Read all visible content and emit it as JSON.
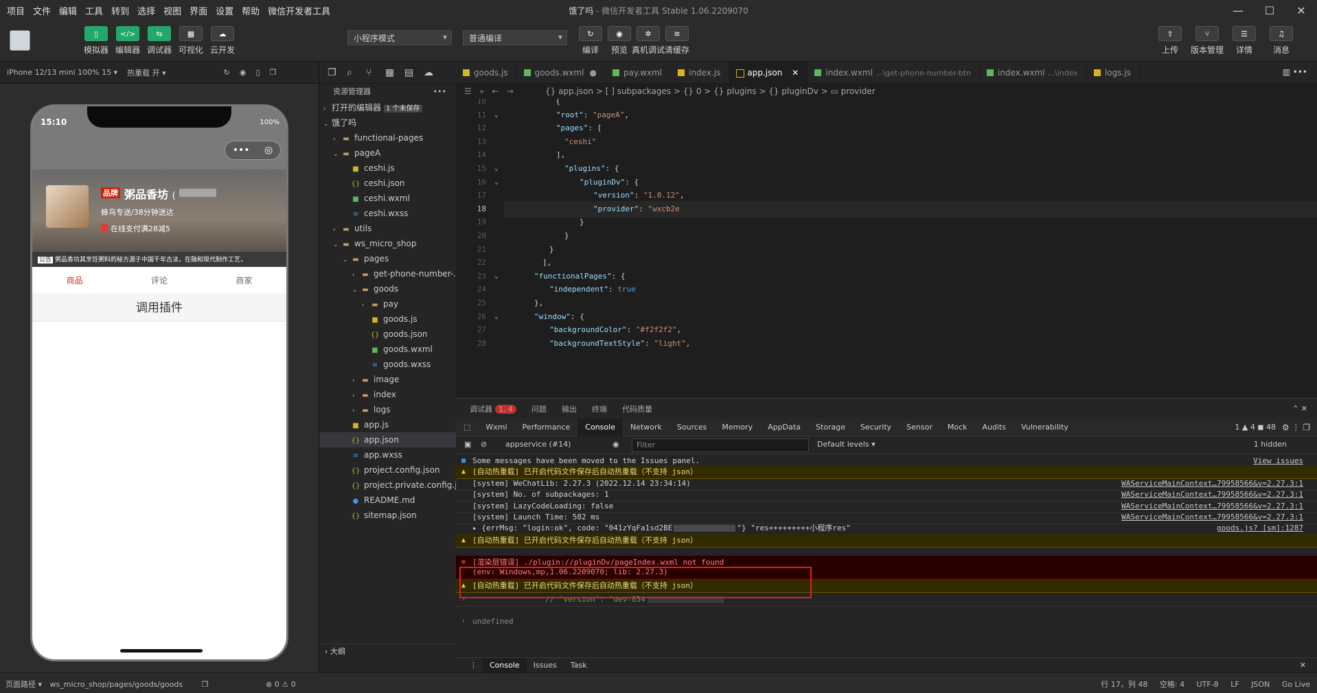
{
  "titlebar": {
    "menu": [
      "项目",
      "文件",
      "编辑",
      "工具",
      "转到",
      "选择",
      "视图",
      "界面",
      "设置",
      "帮助",
      "微信开发者工具"
    ],
    "app_name": "饿了吗",
    "app_title": " - 微信开发者工具 Stable 1.06.2209070"
  },
  "toolbar": {
    "left_buttons": [
      {
        "label": "模拟器",
        "icon": "phone-icon"
      },
      {
        "label": "编辑器",
        "icon": "code-icon"
      },
      {
        "label": "调试器",
        "icon": "debug-icon"
      },
      {
        "label": "可视化",
        "icon": "visual-icon"
      },
      {
        "label": "云开发",
        "icon": "cloud-icon"
      }
    ],
    "mode_select": "小程序模式",
    "compile_select": "普通编译",
    "mid_buttons": [
      {
        "label": "编译"
      },
      {
        "label": "预览"
      },
      {
        "label": "真机调试"
      },
      {
        "label": "清缓存"
      }
    ],
    "right_buttons": [
      {
        "label": "上传"
      },
      {
        "label": "版本管理"
      },
      {
        "label": "详情"
      },
      {
        "label": "消息"
      }
    ]
  },
  "simulator": {
    "device": "iPhone 12/13 mini 100% 15 ▾",
    "hot_reload": "热重载 开 ▾",
    "status_time": "15:10",
    "battery": "100%",
    "brand_badge": "品牌",
    "shop_name": "粥品香坊",
    "shop_suffix": "(",
    "delivery": "蜂鸟专送/38分钟送达",
    "promo": "在线支付满28减5",
    "notice_label": "公告",
    "notice_text": "粥品香坊其烹饪粥料的秘方源于中国千年古法，在融和现代制作工艺，",
    "tabs": [
      "商品",
      "评论",
      "商家"
    ],
    "plugin_button": "调用插件"
  },
  "explorer": {
    "header": "资源管理器",
    "open_editors": "打开的编辑器",
    "unsaved": "1 个未保存",
    "root": "饿了吗",
    "items": [
      {
        "label": "functional-pages",
        "indent": 1,
        "type": "folder",
        "arrow": "›"
      },
      {
        "label": "pageA",
        "indent": 1,
        "type": "folder",
        "arrow": "⌄"
      },
      {
        "label": "ceshi.js",
        "indent": 2,
        "type": "js",
        "arrow": ""
      },
      {
        "label": "ceshi.json",
        "indent": 2,
        "type": "json",
        "arrow": ""
      },
      {
        "label": "ceshi.wxml",
        "indent": 2,
        "type": "wxml",
        "arrow": ""
      },
      {
        "label": "ceshi.wxss",
        "indent": 2,
        "type": "wxss",
        "arrow": ""
      },
      {
        "label": "utils",
        "indent": 1,
        "type": "folder",
        "arrow": "›"
      },
      {
        "label": "ws_micro_shop",
        "indent": 1,
        "type": "folder",
        "arrow": "⌄"
      },
      {
        "label": "pages",
        "indent": 2,
        "type": "folder",
        "arrow": "⌄"
      },
      {
        "label": "get-phone-number-...",
        "indent": 3,
        "type": "folder",
        "arrow": "›"
      },
      {
        "label": "goods",
        "indent": 3,
        "type": "folder",
        "arrow": "⌄"
      },
      {
        "label": "pay",
        "indent": 4,
        "type": "folder",
        "arrow": "›"
      },
      {
        "label": "goods.js",
        "indent": 4,
        "type": "js",
        "arrow": ""
      },
      {
        "label": "goods.json",
        "indent": 4,
        "type": "json",
        "arrow": ""
      },
      {
        "label": "goods.wxml",
        "indent": 4,
        "type": "wxml",
        "arrow": ""
      },
      {
        "label": "goods.wxss",
        "indent": 4,
        "type": "wxss",
        "arrow": ""
      },
      {
        "label": "image",
        "indent": 3,
        "type": "folder",
        "arrow": "›"
      },
      {
        "label": "index",
        "indent": 3,
        "type": "folder",
        "arrow": "›"
      },
      {
        "label": "logs",
        "indent": 3,
        "type": "folder",
        "arrow": "›"
      },
      {
        "label": "app.js",
        "indent": 2,
        "type": "js",
        "arrow": ""
      },
      {
        "label": "app.json",
        "indent": 2,
        "type": "json",
        "arrow": "",
        "selected": true
      },
      {
        "label": "app.wxss",
        "indent": 2,
        "type": "wxss",
        "arrow": ""
      },
      {
        "label": "project.config.json",
        "indent": 2,
        "type": "json",
        "arrow": ""
      },
      {
        "label": "project.private.config.js...",
        "indent": 2,
        "type": "json",
        "arrow": ""
      },
      {
        "label": "README.md",
        "indent": 2,
        "type": "info",
        "arrow": ""
      },
      {
        "label": "sitemap.json",
        "indent": 2,
        "type": "json",
        "arrow": ""
      }
    ],
    "outline": "大纲"
  },
  "editor": {
    "tabs": [
      {
        "label": "goods.js",
        "sub": "",
        "kind": "js"
      },
      {
        "label": "goods.wxml",
        "sub": "",
        "kind": "wx",
        "dot": "●"
      },
      {
        "label": "pay.wxml",
        "sub": "",
        "kind": "wx"
      },
      {
        "label": "index.js",
        "sub": "",
        "kind": "js"
      },
      {
        "label": "app.json",
        "sub": "",
        "kind": "json",
        "active": true,
        "close": "✕"
      },
      {
        "label": "index.wxml",
        "sub": "...\\get-phone-number-btn",
        "kind": "wx"
      },
      {
        "label": "index.wxml",
        "sub": "...\\index",
        "kind": "wx"
      },
      {
        "label": "logs.js",
        "sub": "",
        "kind": "js"
      }
    ],
    "breadcrumb": "{} app.json > [ ] subpackages > {} 0 > {} plugins > {} pluginDv > ▭ provider",
    "lines": [
      {
        "n": "10",
        "text": "  {",
        "indent": 40,
        "fold": ""
      },
      {
        "n": "11",
        "text": "\"root\": \"pageA\",",
        "indent": 54,
        "fold": "⌄",
        "html": "<span class=\"k\">\"root\"</span>: <span class=\"s\">\"pageA\"</span>,"
      },
      {
        "n": "12",
        "text": "\"pages\": [",
        "indent": 54,
        "fold": "",
        "html": "<span class=\"k\">\"pages\"</span>: ["
      },
      {
        "n": "13",
        "text": "\"ceshi\"",
        "indent": 66,
        "fold": "",
        "html": "<span class=\"s\">\"ceshi\"</span>"
      },
      {
        "n": "14",
        "text": "],",
        "indent": 54,
        "fold": "",
        "html": "],"
      },
      {
        "n": "15",
        "text": "\"plugins\": {",
        "indent": 66,
        "fold": "⌄",
        "html": "<span class=\"k\">\"plugins\"</span>: {"
      },
      {
        "n": "16",
        "text": "\"pluginDv\": {",
        "indent": 88,
        "fold": "⌄",
        "html": "<span class=\"k\">\"pluginDv\"</span>: {"
      },
      {
        "n": "17",
        "text": "\"version\": \"1.0.12\",",
        "indent": 108,
        "fold": "",
        "html": "<span class=\"k\">\"version\"</span>: <span class=\"s\">\"1.0.12\"</span>,"
      },
      {
        "n": "18",
        "text": "\"provider\": \"wxcb2e",
        "indent": 108,
        "fold": "",
        "html": "<span class=\"k\">\"provider\"</span>: <span class=\"s\">\"wxcb2e</span>",
        "current": true
      },
      {
        "n": "19",
        "text": "}",
        "indent": 88,
        "fold": "",
        "html": "}"
      },
      {
        "n": "20",
        "text": "}",
        "indent": 66,
        "fold": "",
        "html": "}"
      },
      {
        "n": "21",
        "text": "}",
        "indent": 44,
        "fold": "",
        "html": "}"
      },
      {
        "n": "22",
        "text": "],",
        "indent": 34,
        "fold": "",
        "html": "],"
      },
      {
        "n": "23",
        "text": "\"functionalPages\": {",
        "indent": 22,
        "fold": "⌄",
        "html": "<span class=\"k\">\"functionalPages\"</span>: {"
      },
      {
        "n": "24",
        "text": "\"independent\": true",
        "indent": 44,
        "fold": "",
        "html": "<span class=\"k\">\"independent\"</span>: <span class=\"b\">true</span>"
      },
      {
        "n": "25",
        "text": "},",
        "indent": 22,
        "fold": "",
        "html": "},"
      },
      {
        "n": "26",
        "text": "\"window\": {",
        "indent": 22,
        "fold": "⌄",
        "html": "<span class=\"k\">\"window\"</span>: {"
      },
      {
        "n": "27",
        "text": "\"backgroundColor\": \"#f2f2f2\",",
        "indent": 44,
        "fold": "",
        "html": "<span class=\"k\">\"backgroundColor\"</span>: <span class=\"s\">\"#f2f2f2\"</span>,"
      },
      {
        "n": "28",
        "text": "\"backgroundTextStyle\": \"light\",",
        "indent": 44,
        "fold": "",
        "html": "<span class=\"k\">\"backgroundTextStyle\"</span>: <span class=\"s\">\"light\"</span>,"
      }
    ]
  },
  "debug": {
    "tabs": [
      {
        "label": "调试器",
        "badge": "1, 4",
        "active": true
      },
      {
        "label": "问题"
      },
      {
        "label": "输出"
      },
      {
        "label": "终端"
      },
      {
        "label": "代码质量"
      }
    ],
    "devtools_tabs": [
      "Wxml",
      "Performance",
      "Console",
      "Network",
      "Sources",
      "Memory",
      "AppData",
      "Storage",
      "Security",
      "Sensor",
      "Mock",
      "Audits",
      "Vulnerability"
    ],
    "devtools_active": "Console",
    "counts": "1 ▲ 4 ◼ 48",
    "context": "appservice (#14)",
    "filter_placeholder": "Filter",
    "levels": "Default levels ▾",
    "hidden": "1 hidden",
    "messages": [
      {
        "type": "info",
        "text": "Some messages have been moved to the Issues panel.",
        "src": "View issues"
      },
      {
        "type": "warn",
        "text": "[自动热重载] 已开启代码文件保存后自动热重载（不支持 json）",
        "src": ""
      },
      {
        "type": "log",
        "text": "[system] WeChatLib: 2.27.3 (2022.12.14 23:34:14)",
        "src": "WAServiceMainContext…79958566&v=2.27.3:1"
      },
      {
        "type": "log",
        "text": "[system] No. of subpackages: 1",
        "src": "WAServiceMainContext…79958566&v=2.27.3:1"
      },
      {
        "type": "log",
        "text": "[system] LazyCodeLoading: false",
        "src": "WAServiceMainContext…79958566&v=2.27.3:1"
      },
      {
        "type": "log",
        "text": "[system] Launch Time: 582 ms",
        "src": "WAServiceMainContext…79958566&v=2.27.3:1"
      },
      {
        "type": "log",
        "text": "▸ {errMsg: \"login:ok\", code: \"041zYqFa1sd2BE",
        "suffix": "\"} \"res+++++++++小程序res\"",
        "src": "goods.js? [sm]:1287"
      },
      {
        "type": "warn",
        "text": "[自动热重载] 已开启代码文件保存后自动热重载（不支持 json）",
        "src": ""
      }
    ],
    "error_line1": "[渲染层错误] ./plugin://pluginDv/pageIndex.wxml not found",
    "error_line2": "(env: Windows,mp,1.06.2209070; lib: 2.27.3)",
    "warn_after": "[自动热重载] 已开启代码文件保存后自动热重载（不支持 json）",
    "comment_line": "// \"version\": \"dev-854",
    "undefined_line": "undefined",
    "bottom_tabs": [
      "Console",
      "Issues",
      "Task"
    ]
  },
  "statusbar": {
    "path_label": "页面路径 ▾",
    "path": "ws_micro_shop/pages/goods/goods",
    "problems": "⊗ 0 ⚠ 0",
    "position": "行 17，列 48",
    "spaces": "空格: 4",
    "encoding": "UTF-8",
    "eol": "LF",
    "lang": "JSON",
    "golive": "Go Live"
  },
  "colors": {
    "accent_green": "#23a86b",
    "error_red": "#e0201a",
    "warn_bg": "#332b00"
  }
}
